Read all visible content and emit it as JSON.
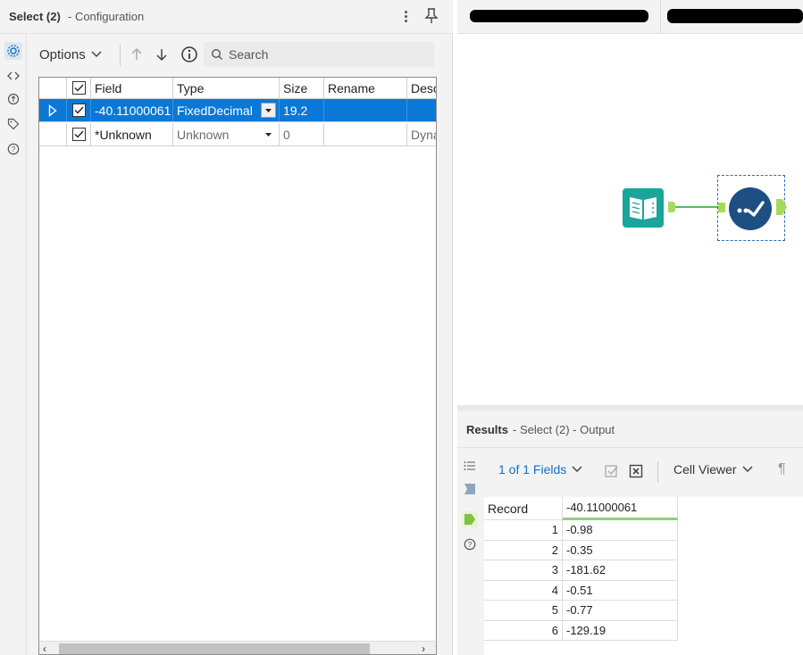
{
  "config": {
    "title": "Select (2)",
    "subtitle": "- Configuration",
    "toolbar": {
      "options_label": "Options",
      "search_placeholder": "Search"
    },
    "grid": {
      "columns": [
        "Field",
        "Type",
        "Size",
        "Rename",
        "Desc"
      ],
      "rows": [
        {
          "field": "-40.11000061",
          "type": "FixedDecimal",
          "size": "19.2",
          "rename": "",
          "desc": "",
          "checked": true,
          "selected": true
        },
        {
          "field": "*Unknown",
          "type": "Unknown",
          "size": "0",
          "rename": "",
          "desc": "Dyna",
          "checked": true,
          "selected": false
        }
      ]
    }
  },
  "canvas": {
    "tabs": [
      {
        "label": ""
      },
      {
        "label": ""
      }
    ],
    "tools": [
      "input-data-tool",
      "select-tool"
    ]
  },
  "results": {
    "title": "Results",
    "subtitle": "- Select (2) - Output",
    "fields_label": "1 of 1 Fields",
    "cell_viewer_label": "Cell Viewer",
    "table": {
      "record_header": "Record",
      "value_header": "-40.11000061",
      "rows": [
        {
          "record": "1",
          "value": "-0.98"
        },
        {
          "record": "2",
          "value": "-0.35"
        },
        {
          "record": "3",
          "value": "-181.62"
        },
        {
          "record": "4",
          "value": "-0.51"
        },
        {
          "record": "5",
          "value": "-0.77"
        },
        {
          "record": "6",
          "value": "-129.19"
        }
      ]
    }
  },
  "colors": {
    "selection": "#0c78d6",
    "link_blue": "#1570c4",
    "input_tool": "#19a59a",
    "select_tool": "#1e4f82",
    "anchor_green": "#a7d95c"
  }
}
